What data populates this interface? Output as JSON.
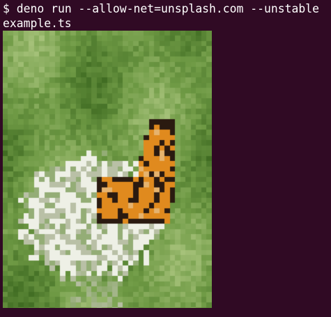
{
  "terminal": {
    "prompt": "$",
    "command_line_1": "deno run --allow-net=unsplash.com --unstable",
    "command_line_2": "example.ts"
  },
  "image": {
    "subject_icon": "butterfly-on-flowers-pixelated-image",
    "colors": {
      "background": "#300a24",
      "foreground": "#ffffff",
      "leaf_dark": "#3f6b22",
      "leaf_mid": "#6f9a45",
      "leaf_light": "#a6c27a",
      "flower_white": "#eef0e6",
      "flower_shadow": "#b9c0a6",
      "wing_orange": "#e08a1e",
      "wing_black": "#2a1a10"
    }
  }
}
